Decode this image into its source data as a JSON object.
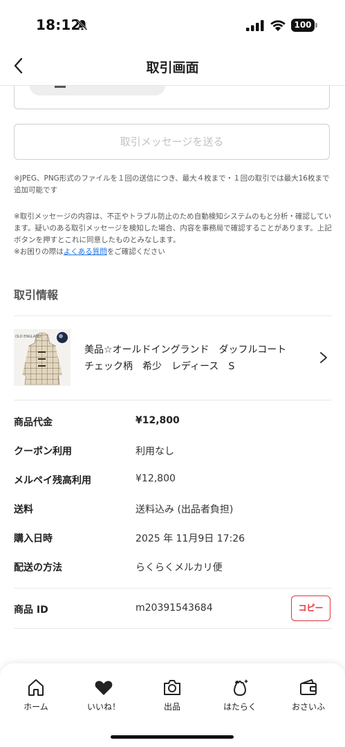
{
  "status_bar": {
    "time": "18:12",
    "battery": "100"
  },
  "header": {
    "title": "取引画面"
  },
  "message": {
    "send_label": "取引メッセージを送る"
  },
  "notes": {
    "upload_note": "※JPEG、PNG形式のファイルを１回の送信につき、最大４枚まで・１回の取引では最大16枚まで追加可能です",
    "policy_note": "※取引メッセージの内容は、不正やトラブル防止のため自動検知システムのもと分析・確認しています。疑いのある取引メッセージを検知した場合、内容を事務局で確認することがあります。上記ボタンを押すとこれに同意したものとみなします。",
    "help_prefix": "※お困りの際は",
    "help_link": "よくある質問",
    "help_suffix": "をご確認ください"
  },
  "transaction": {
    "section_title": "取引情報",
    "item_name": "美品☆オールドイングランド　ダッフルコート　チェック柄　希少　レディース　S",
    "thumb_logo": "OLD ENGLAND",
    "rows": [
      {
        "label": "商品代金",
        "value": "¥12,800"
      },
      {
        "label": "クーポン利用",
        "value": "利用なし"
      },
      {
        "label": "メルペイ残高利用",
        "value": "¥12,800"
      },
      {
        "label": "送料",
        "value": "送料込み (出品者負担)"
      },
      {
        "label": "購入日時",
        "value": "2025 年 11月9日 17:26"
      },
      {
        "label": "配送の方法",
        "value": "らくらくメルカリ便"
      }
    ],
    "product_id_label": "商品 ID",
    "product_id": "m20391543684",
    "copy_label": "コピー"
  },
  "tab_bar": {
    "tabs": [
      {
        "label": "ホーム",
        "icon": "home-icon"
      },
      {
        "label": "いいね！",
        "icon": "heart-icon"
      },
      {
        "label": "出品",
        "icon": "camera-icon"
      },
      {
        "label": "はたらく",
        "icon": "work-bag-icon"
      },
      {
        "label": "おさいふ",
        "icon": "wallet-icon"
      }
    ]
  },
  "colors": {
    "accent_red": "#e1323d",
    "link_blue": "#1a73e8"
  }
}
